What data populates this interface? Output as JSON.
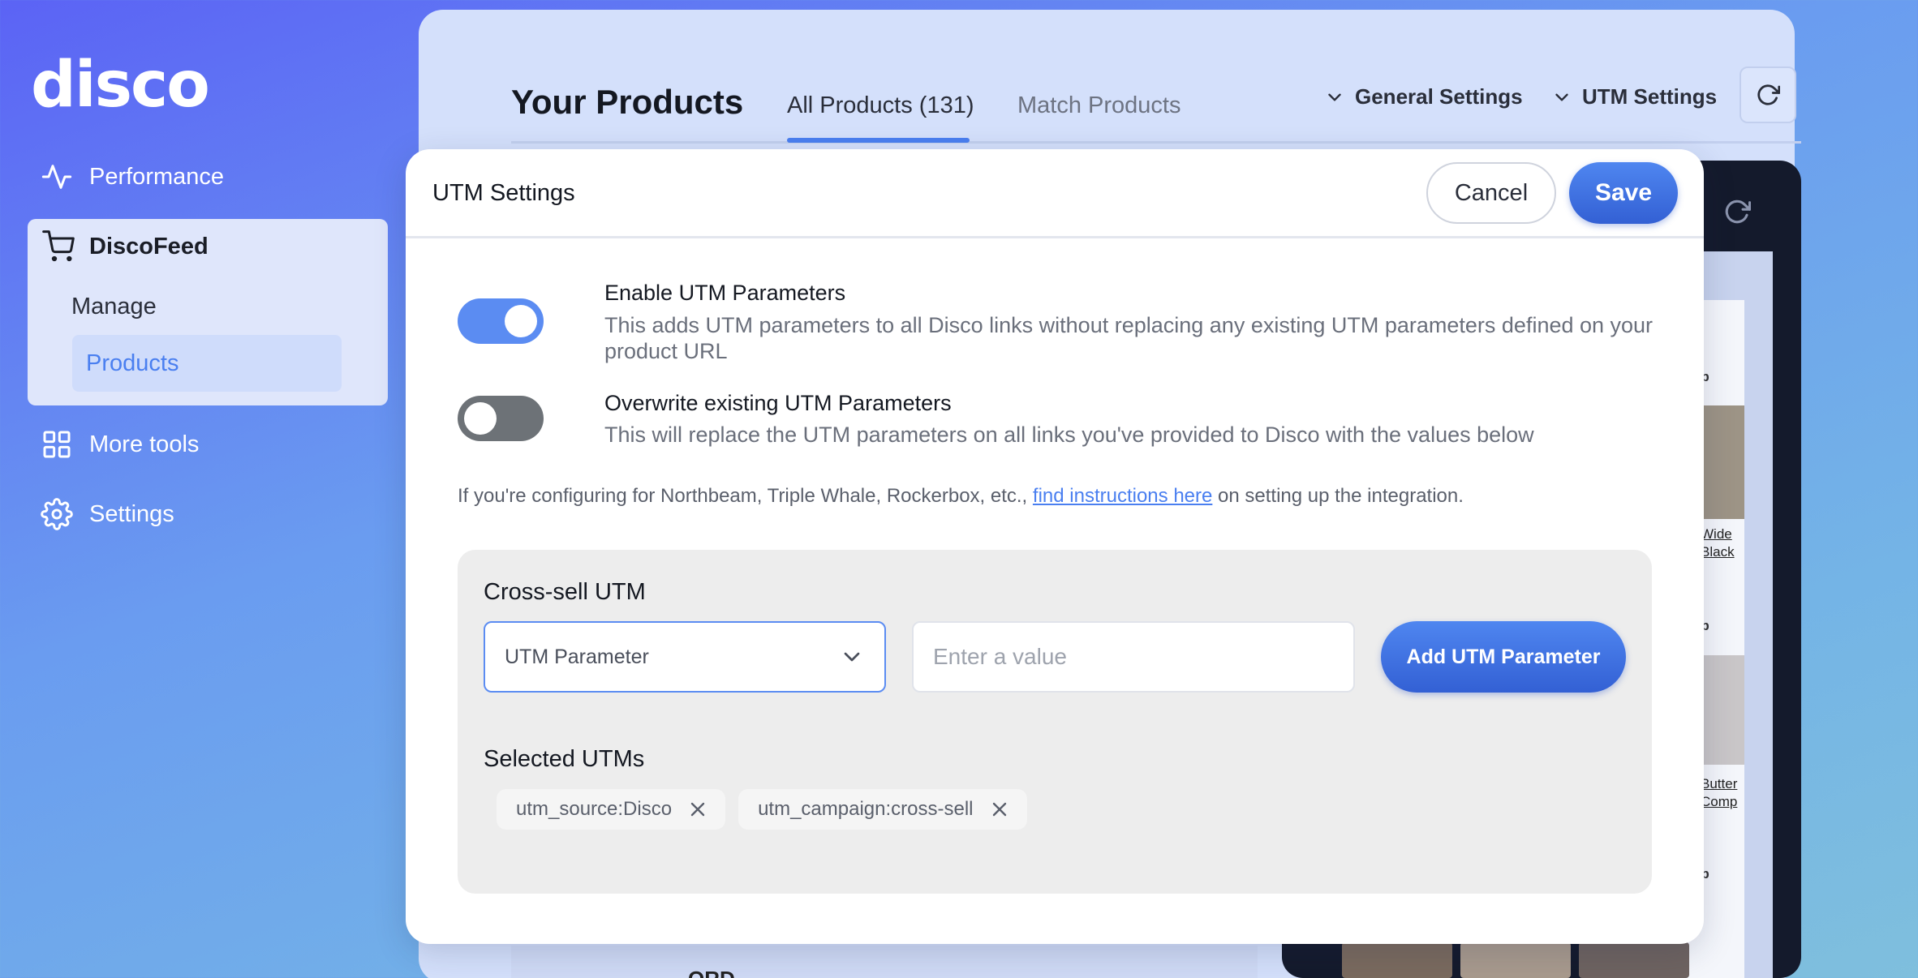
{
  "brand": {
    "logo_text": "disco"
  },
  "sidebar": {
    "performance": "Performance",
    "discofeed": "DiscoFeed",
    "manage": "Manage",
    "products": "Products",
    "more_tools": "More tools",
    "settings": "Settings"
  },
  "header": {
    "title": "Your Products",
    "tabs": [
      {
        "label": "All Products (131)",
        "active": true
      },
      {
        "label": "Match Products",
        "active": false
      }
    ],
    "general_settings": "General Settings",
    "utm_settings": "UTM Settings"
  },
  "preview": {
    "row_labels": [
      "op",
      "op",
      "op"
    ],
    "links": [
      "Wide",
      "Black",
      "Butter",
      "Comp"
    ],
    "bottom_text": "ORD"
  },
  "modal": {
    "title": "UTM Settings",
    "cancel_label": "Cancel",
    "save_label": "Save",
    "enable": {
      "title": "Enable UTM Parameters",
      "description": "This adds UTM parameters to all Disco links without replacing any existing UTM parameters defined on your product URL",
      "on": true
    },
    "overwrite": {
      "title": "Overwrite existing UTM Parameters",
      "description": "This will replace the UTM parameters on all links you've provided to Disco with the values below",
      "on": false
    },
    "info_prefix": "If you're configuring for Northbeam, Triple Whale, Rockerbox, etc.,",
    "info_link": "find instructions here",
    "info_suffix": "on setting up the integration.",
    "cross_sell": {
      "title": "Cross-sell UTM",
      "select_value": "UTM Parameter",
      "input_placeholder": "Enter a value",
      "add_label": "Add UTM Parameter",
      "selected_title": "Selected UTMs",
      "chips": [
        "utm_source:Disco",
        "utm_campaign:cross-sell"
      ]
    }
  },
  "colors": {
    "accent": "#4a7ff0",
    "toggle_on": "#5b8cf2",
    "toggle_off": "#6d7277"
  }
}
